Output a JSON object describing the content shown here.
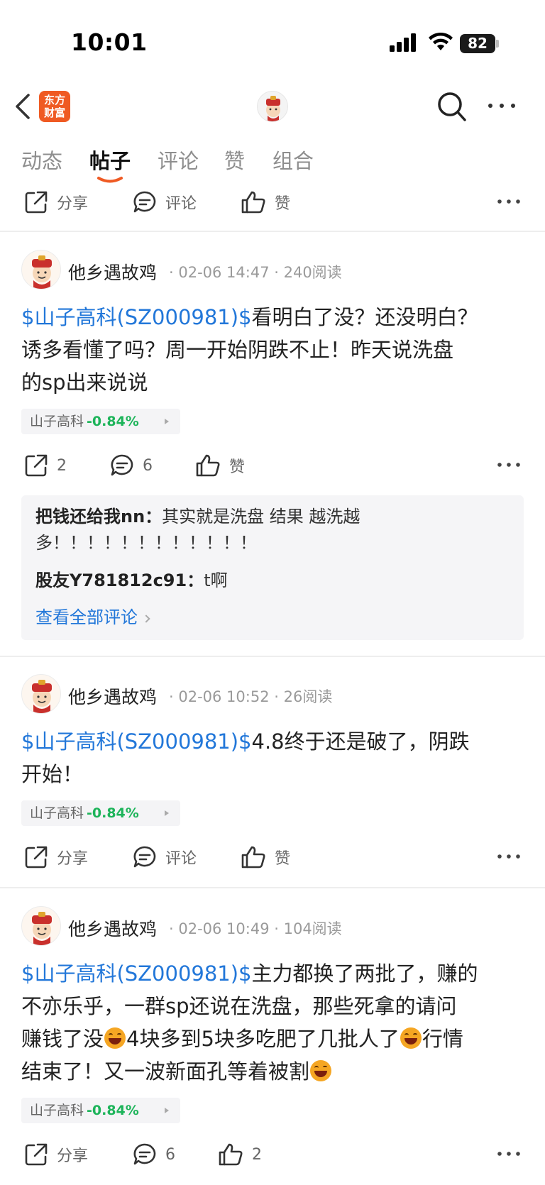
{
  "status_bar": {
    "time": "10:01",
    "battery": "82"
  },
  "nav": {
    "logo_line1": "东方",
    "logo_line2": "财富"
  },
  "tabs": [
    {
      "label": "动态"
    },
    {
      "label": "帖子"
    },
    {
      "label": "评论"
    },
    {
      "label": "赞"
    },
    {
      "label": "组合"
    }
  ],
  "top_actions": {
    "share": "分享",
    "comment": "评论",
    "like": "赞"
  },
  "posts": [
    {
      "author": "他乡遇故鸡",
      "meta": "· 02-06 14:47 · 240阅读",
      "stock_tag": "$山子高科(SZ000981)$",
      "text_line1": "看明白了没？还没明白？",
      "text_line2": "诱多看懂了吗？周一开始阴跌不止！昨天说洗盘",
      "text_line3": "的sp出来说说",
      "chip_name": "山子高科",
      "chip_pct": "-0.84%",
      "share": "2",
      "comments": "6",
      "like": "赞"
    },
    {
      "author": "他乡遇故鸡",
      "meta": "· 02-06 10:52 · 26阅读",
      "stock_tag": "$山子高科(SZ000981)$",
      "text_line1": "4.8终于还是破了，阴跌",
      "text_line2": "开始！",
      "chip_name": "山子高科",
      "chip_pct": "-0.84%",
      "share": "分享",
      "comments": "评论",
      "like": "赞"
    },
    {
      "author": "他乡遇故鸡",
      "meta": "· 02-06 10:49 · 104阅读",
      "stock_tag": "$山子高科(SZ000981)$",
      "text_line1": "主力都换了两批了，赚的",
      "text_line2": "不亦乐乎，一群sp还说在洗盘，那些死拿的请问",
      "text_line3a": "赚钱了没",
      "text_line3b": "4块多到5块多吃肥了几批人了",
      "text_line3c": "行情",
      "text_line4": "结束了！又一波新面孔等着被割",
      "chip_name": "山子高科",
      "chip_pct": "-0.84%",
      "share": "分享",
      "comments": "6",
      "like": "2"
    }
  ],
  "comments_box": {
    "c1_user": "把钱还给我nn：",
    "c1_text_a": "其实就是洗盘  结果   越洗越",
    "c1_text_b": "多！！！！！！！！！！！！",
    "c2_user": "股友Y781812c91：",
    "c2_text": "t啊",
    "view_all": "查看全部评论"
  },
  "icons": {
    "back": "chevron-left-icon",
    "search": "search-icon",
    "more": "more-dots-icon",
    "share": "share-icon",
    "comment": "comment-bubble-icon",
    "like": "thumbs-up-icon"
  },
  "colors": {
    "accent_blue": "#2277d9",
    "negative_green": "#1db45a",
    "brand_orange": "#ef5a23",
    "tab_underline": "#ef5a23"
  }
}
